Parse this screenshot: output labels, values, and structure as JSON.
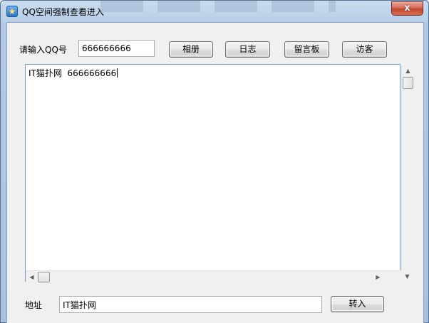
{
  "window": {
    "title": "QQ空间强制查看进入",
    "close_glyph": "x",
    "icon": "star-app-icon"
  },
  "form": {
    "qq_label": "请输入QQ号",
    "qq_value": "666666666",
    "buttons": {
      "album": "相册",
      "diary": "日志",
      "guestbook": "留言板",
      "visitors": "访客"
    }
  },
  "memo": {
    "text": "IT猫扑网  666666666"
  },
  "address": {
    "label": "地址",
    "value": "IT猫扑网",
    "go_button": "转入"
  }
}
